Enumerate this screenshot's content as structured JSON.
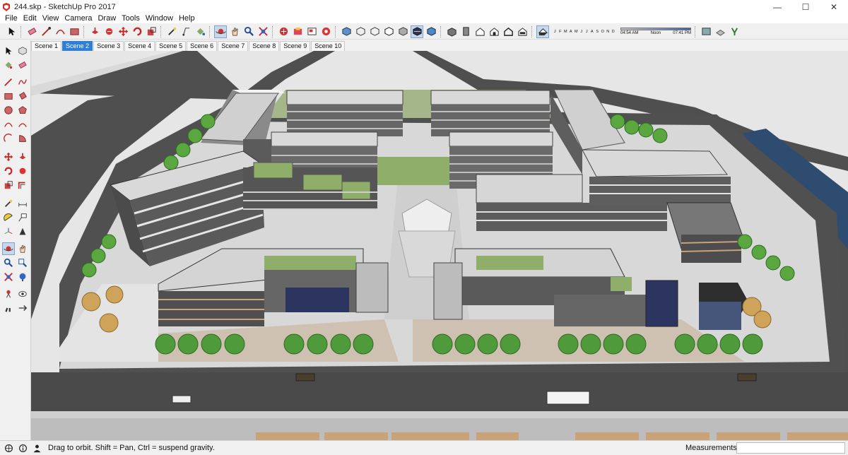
{
  "window": {
    "title": "244.skp - SketchUp Pro 2017",
    "minimize": "—",
    "maximize": "☐",
    "close": "✕"
  },
  "menu": [
    "File",
    "Edit",
    "View",
    "Camera",
    "Draw",
    "Tools",
    "Window",
    "Help"
  ],
  "shadow": {
    "months": [
      "J",
      "F",
      "M",
      "A",
      "M",
      "J",
      "J",
      "A",
      "S",
      "O",
      "N",
      "D"
    ],
    "time_start": "04:54 AM",
    "time_mid": "Noon",
    "time_end": "07:41 PM"
  },
  "scenes": {
    "tabs": [
      "Scene 1",
      "Scene 2",
      "Scene 3",
      "Scene 4",
      "Scene 5",
      "Scene 6",
      "Scene 7",
      "Scene 8",
      "Scene 9",
      "Scene 10"
    ],
    "active": "Scene 2"
  },
  "status": {
    "hint": "Drag to orbit. Shift = Pan, Ctrl = suspend gravity.",
    "measurements_label": "Measurements",
    "measurements_value": ""
  },
  "colors": {
    "accent": "#2f7fd6",
    "ground": "#e9e9e9",
    "road": "#4d4d4d",
    "water": "#2e4c70",
    "lawn": "#8fae6a",
    "tree": "#4f9a3a"
  },
  "toolbar_icons": [
    "select-icon",
    "eraser-icon",
    "line-icon",
    "shape-icon",
    "paint-icon",
    "move-icon",
    "rotate-icon",
    "offset-icon",
    "pushpull-icon",
    "tape-icon",
    "text-icon",
    "orbit-icon",
    "pan-icon",
    "zoom-icon",
    "zoom-extents-icon",
    "house-icon",
    "shadow-icon"
  ]
}
